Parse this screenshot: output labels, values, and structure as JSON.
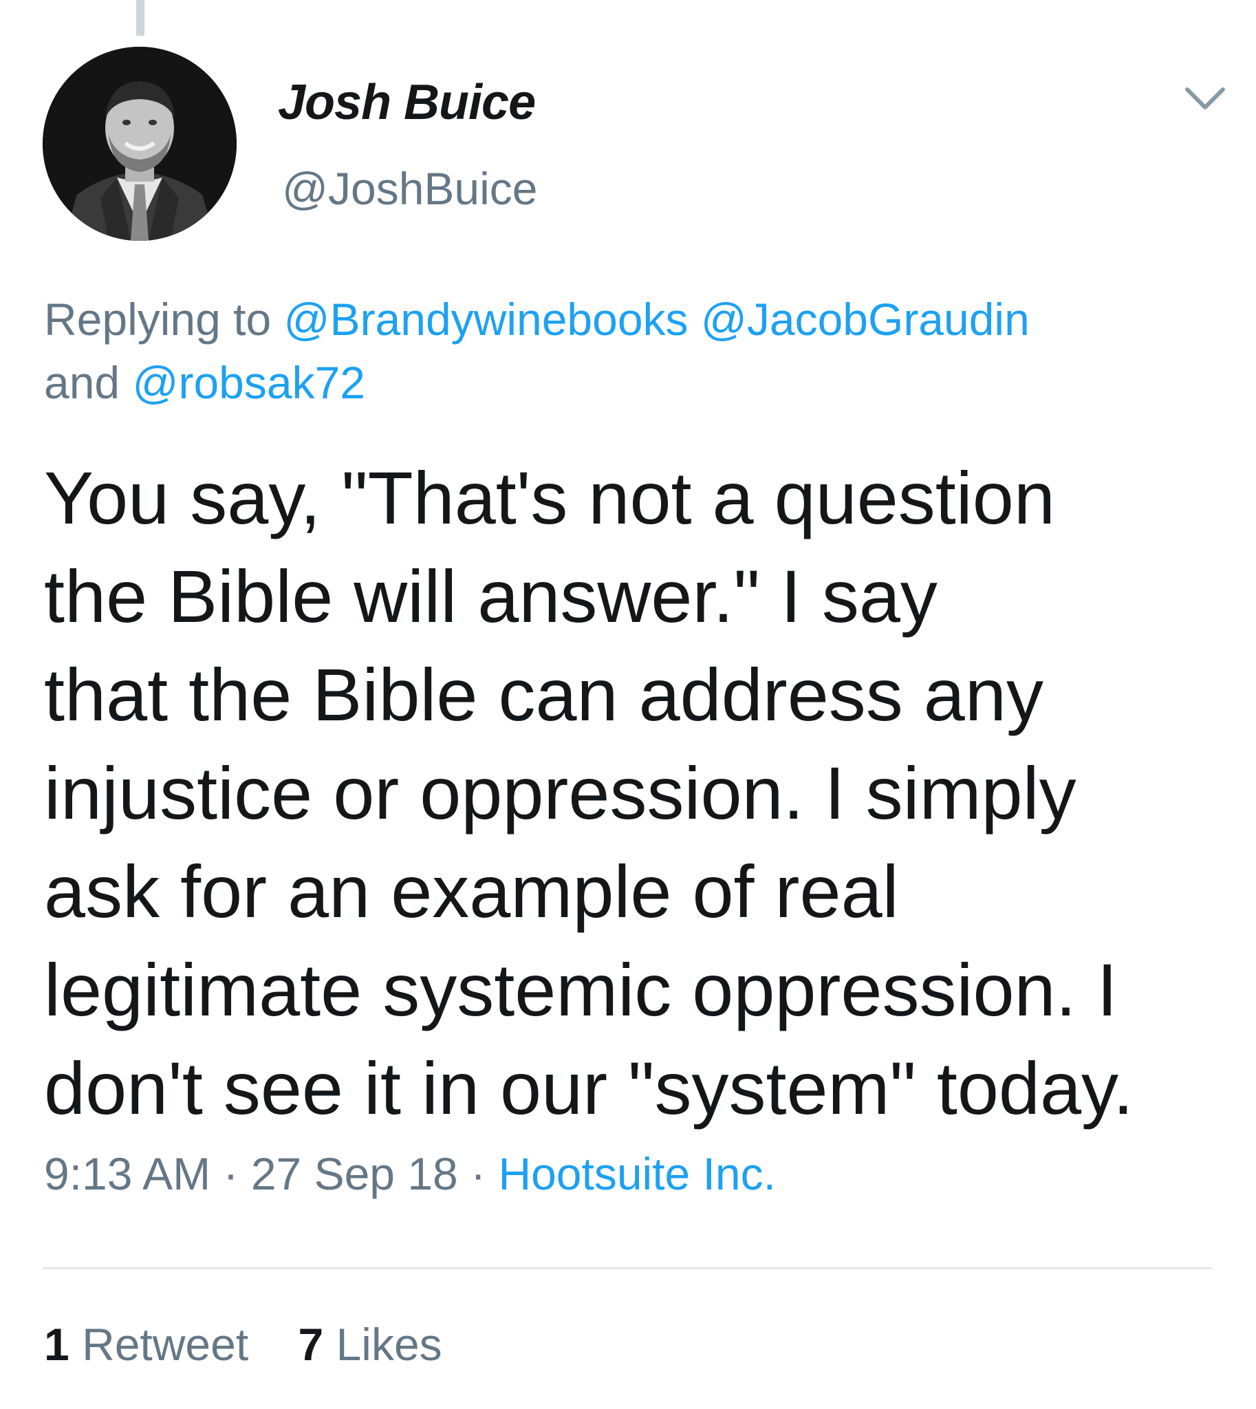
{
  "author": {
    "display_name": "Josh Buice",
    "handle": "@JoshBuice"
  },
  "reply_context": {
    "prefix": "Replying to",
    "mentions": [
      "@Brandywinebooks",
      "@JacobGraudin"
    ],
    "conjunction": "and",
    "last_mention": "@robsak72"
  },
  "tweet": {
    "lines": [
      "You say, \"That's not a question",
      "the Bible will answer.\" I say",
      "that the Bible can address any",
      "injustice or oppression. I simply",
      "ask for an example of real",
      "legitimate systemic oppression. I",
      "don't see it in our \"system\" today."
    ]
  },
  "meta": {
    "time": "9:13 AM",
    "separator": "·",
    "date": "27 Sep 18",
    "source": "Hootsuite Inc."
  },
  "stats": {
    "retweets_count": "1",
    "retweets_label": "Retweet",
    "likes_count": "7",
    "likes_label": "Likes"
  },
  "icons": {
    "menu": "chevron-down-icon",
    "avatar": "profile-photo"
  },
  "colors": {
    "text": "#14171a",
    "secondary": "#657786",
    "link": "#1da1f2",
    "divider": "#e1e8ed"
  }
}
